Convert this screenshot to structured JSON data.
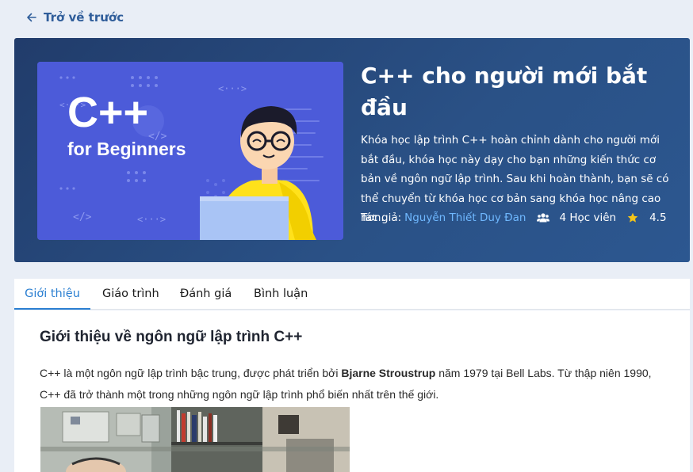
{
  "nav": {
    "back_label": "Trở về trước"
  },
  "thumbnail": {
    "line1": "C++",
    "line2": "for Beginners"
  },
  "course": {
    "title": "C++ cho người mới bắt đầu",
    "description": "Khóa học lập trình C++ hoàn chỉnh dành cho người mới bắt đầu, khóa học này dạy cho bạn những kiến thức cơ bản về ngôn ngữ lập trình. Sau khi hoàn thành, bạn sẽ có thể chuyển từ khóa học cơ bản sang khóa học nâng cao hơn.",
    "author_label": "Tác giả:",
    "author_name": "Nguyễn Thiết Duy Đan",
    "students": "4 Học viên",
    "rating": "4.5"
  },
  "tabs": [
    {
      "label": "Giới thiệu"
    },
    {
      "label": "Giáo trình"
    },
    {
      "label": "Đánh giá"
    },
    {
      "label": "Bình luận"
    }
  ],
  "content": {
    "title": "Giới thiệu về ngôn ngữ lập trình C++",
    "para_part1": "C++ là một ngôn ngữ lập trình bậc trung, được phát triển bởi ",
    "para_bold": "Bjarne Stroustrup",
    "para_part2": " năm 1979 tại Bell Labs. Từ thập niên 1990, C++ đã trở thành một trong những ngôn ngữ lập trình phổ biến nhất trên thế giới."
  },
  "colors": {
    "page_bg": "#e9eef6",
    "hero_bg": "#25477a",
    "accent": "#2b7fd1",
    "author_link": "#6fb8ff",
    "star": "#f5c518"
  },
  "icons": {
    "back": "arrow-left-icon",
    "students": "users-icon",
    "rating": "star-icon"
  }
}
